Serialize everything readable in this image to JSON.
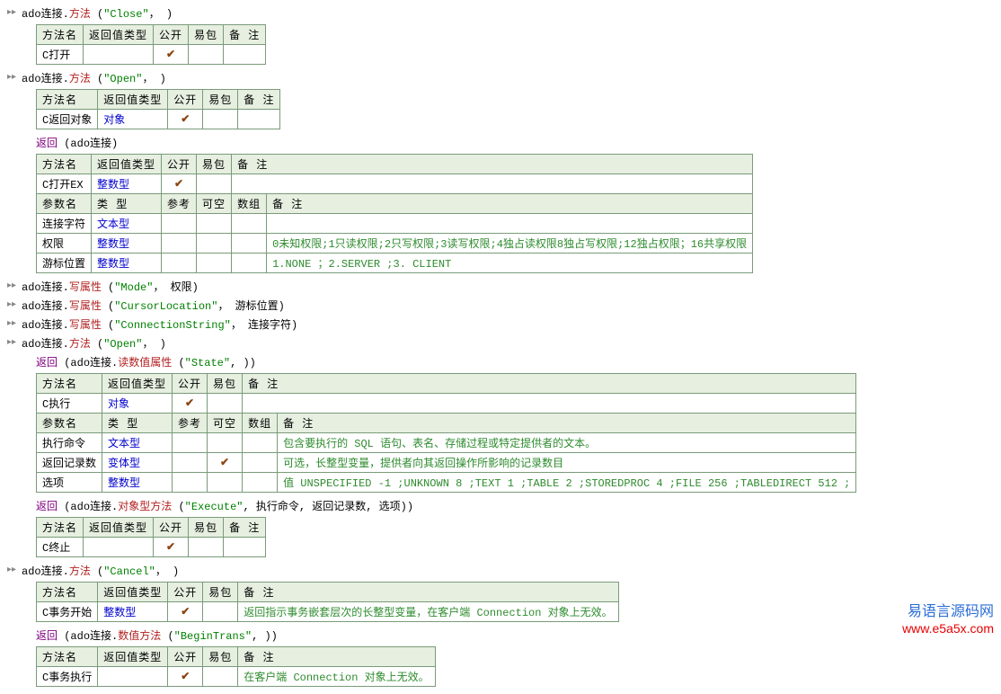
{
  "hdr": {
    "name": "方法名",
    "ret": "返回值类型",
    "pub": "公开",
    "ez": "易包",
    "note": "备 注",
    "pname": "参数名",
    "ptype": "类 型",
    "ref": "参考",
    "null": "可空",
    "arr": "数组"
  },
  "watermark": {
    "t1": "易语言源码网",
    "t2": "www.e5a5x.com"
  },
  "l1": {
    "obj": "ado连接",
    "dot": ".",
    "m": "方法",
    "lp": " (",
    "q1": "\"Close\"",
    "c": "， )"
  },
  "t1": {
    "name": "C打开"
  },
  "l2": {
    "obj": "ado连接",
    "m": "方法",
    "q": "\"Open\"",
    "c": "， )"
  },
  "t2": {
    "name": "C返回对象",
    "ret": "对象"
  },
  "l3": {
    "r": "返回",
    "p": " (ado连接)"
  },
  "t3a": {
    "name": "C打开EX",
    "ret": "整数型"
  },
  "t3b": {
    "r1": {
      "n": "连接字符",
      "t": "文本型"
    },
    "r2": {
      "n": "权限",
      "t": "整数型",
      "note": "0未知权限;1只读权限;2只写权限;3读写权限;4独占读权限8独占写权限;12独占权限；16共享权限"
    },
    "r3": {
      "n": "游标位置",
      "t": "整数型",
      "note": "1.NONE ；2.SERVER ;3. CLIENT"
    }
  },
  "l4": {
    "obj": "ado连接",
    "a": "写属性",
    "q": "\"Mode\"",
    "txt": "， 权限)"
  },
  "l5": {
    "obj": "ado连接",
    "a": "写属性",
    "q": "\"CursorLocation\"",
    "txt": "， 游标位置)"
  },
  "l6": {
    "obj": "ado连接",
    "a": "写属性",
    "q": "\"ConnectionString\"",
    "txt": "， 连接字符)"
  },
  "l7": {
    "obj": "ado连接",
    "m": "方法",
    "q": "\"Open\"",
    "c": "， )"
  },
  "l8": {
    "r": "返回",
    "p1": " (ado连接.",
    "a": "读数值属性",
    "p2": " (",
    "q": "\"State\"",
    "p3": ", ))"
  },
  "t4a": {
    "name": "C执行",
    "ret": "对象"
  },
  "t4b": {
    "r1": {
      "n": "执行命令",
      "t": "文本型",
      "note": "包含要执行的 SQL 语句、表名、存储过程或特定提供者的文本。"
    },
    "r2": {
      "n": "返回记录数",
      "t": "变体型",
      "note": "可选，长整型变量，提供者向其返回操作所影响的记录数目"
    },
    "r3": {
      "n": "选项",
      "t": "整数型",
      "note": "值 UNSPECIFIED -1 ;UNKNOWN 8 ;TEXT 1 ;TABLE 2 ;STOREDPROC 4 ;FILE 256 ;TABLEDIRECT 512 ;"
    }
  },
  "l9": {
    "r": "返回",
    "p1": " (ado连接.",
    "a": "对象型方法",
    "p2": " (",
    "q": "\"Execute\"",
    "p3": ", 执行命令, 返回记录数, 选项))"
  },
  "t5": {
    "name": "C终止"
  },
  "l10": {
    "obj": "ado连接",
    "m": "方法",
    "q": "\"Cancel\"",
    "c": "， )"
  },
  "t6": {
    "name": "C事务开始",
    "ret": "整数型",
    "note": "返回指示事务嵌套层次的长整型变量，在客户端 Connection 对象上无效。"
  },
  "l11": {
    "r": "返回",
    "p1": " (ado连接.",
    "a": "数值方法",
    "p2": " (",
    "q": "\"BeginTrans\"",
    "p3": ", ))"
  },
  "t7": {
    "name": "C事务执行",
    "note": "在客户端 Connection 对象上无效。"
  }
}
